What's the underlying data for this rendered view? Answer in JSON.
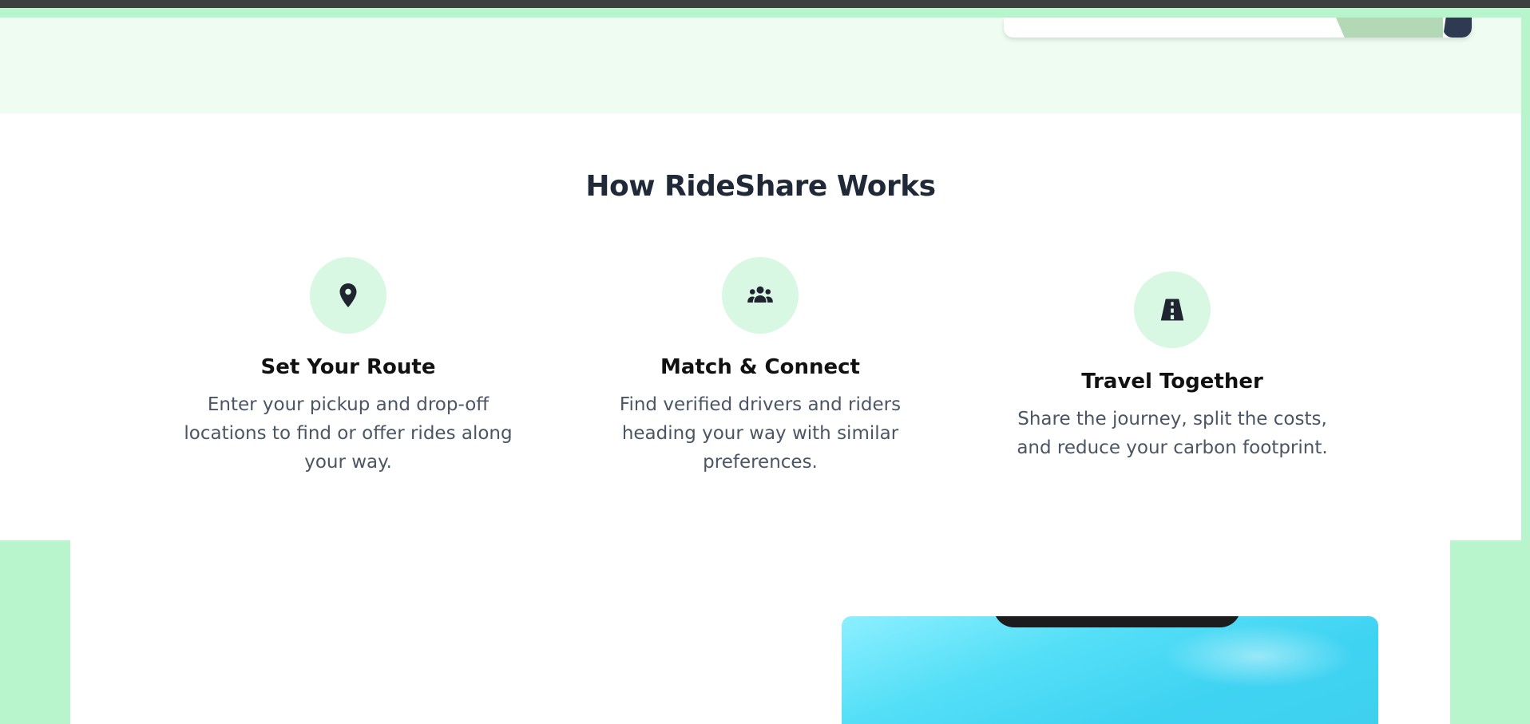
{
  "section": {
    "title": "How RideShare Works"
  },
  "steps": [
    {
      "icon": "map-pin-icon",
      "title": "Set Your Route",
      "description": "Enter your pickup and drop-off locations to find or offer rides along your way."
    },
    {
      "icon": "users-icon",
      "title": "Match & Connect",
      "description": "Find verified drivers and riders heading your way with similar preferences."
    },
    {
      "icon": "road-icon",
      "title": "Travel Together",
      "description": "Share the journey, split the costs, and reduce your carbon footprint."
    }
  ],
  "colors": {
    "page_background": "#b9f5cc",
    "hero_background": "#effcf2",
    "icon_circle": "#d9f8e3",
    "heading": "#1f2937",
    "body_text": "#4b5563"
  }
}
